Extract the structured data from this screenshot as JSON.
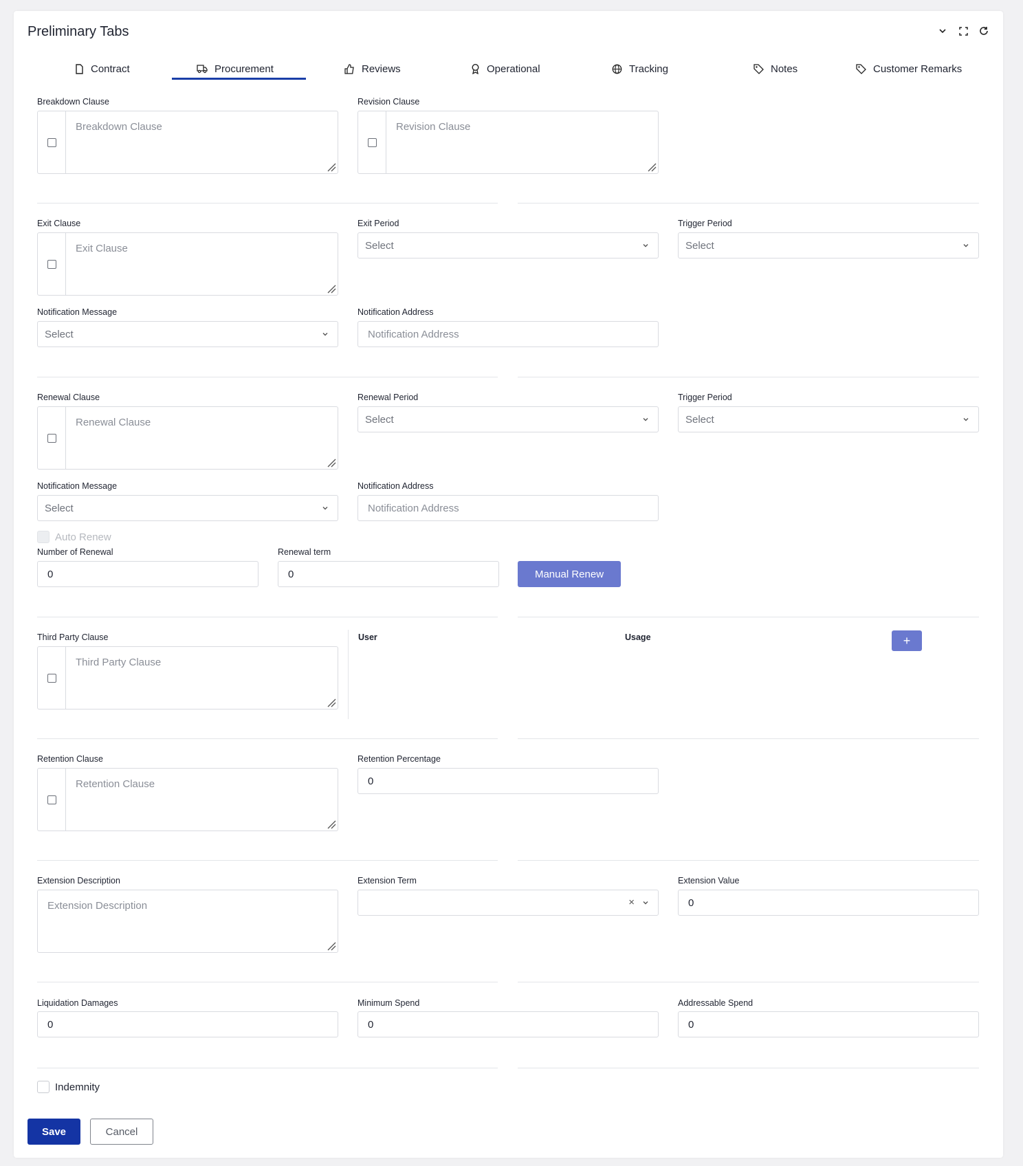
{
  "header": {
    "title": "Preliminary Tabs"
  },
  "tabs": [
    {
      "label": "Contract",
      "icon": "file-icon"
    },
    {
      "label": "Procurement",
      "icon": "truck-icon",
      "active": true
    },
    {
      "label": "Reviews",
      "icon": "thumbs-up-icon"
    },
    {
      "label": "Operational",
      "icon": "award-icon"
    },
    {
      "label": "Tracking",
      "icon": "globe-icon"
    },
    {
      "label": "Notes",
      "icon": "tag-icon"
    },
    {
      "label": "Customer Remarks",
      "icon": "tag-icon"
    }
  ],
  "breakdown": {
    "label": "Breakdown Clause",
    "placeholder": "Breakdown Clause"
  },
  "revision": {
    "label": "Revision Clause",
    "placeholder": "Revision Clause"
  },
  "exit": {
    "label": "Exit Clause",
    "placeholder": "Exit Clause",
    "period_label": "Exit Period",
    "period_value": "Select",
    "trigger_label": "Trigger Period",
    "trigger_value": "Select",
    "notif_msg_label": "Notification Message",
    "notif_msg_value": "Select",
    "notif_addr_label": "Notification Address",
    "notif_addr_placeholder": "Notification Address"
  },
  "renewal": {
    "label": "Renewal Clause",
    "placeholder": "Renewal Clause",
    "period_label": "Renewal Period",
    "period_value": "Select",
    "trigger_label": "Trigger Period",
    "trigger_value": "Select",
    "notif_msg_label": "Notification Message",
    "notif_msg_value": "Select",
    "notif_addr_label": "Notification Address",
    "notif_addr_placeholder": "Notification Address",
    "auto_renew_label": "Auto Renew",
    "number_label": "Number of Renewal",
    "number_value": "0",
    "term_label": "Renewal term",
    "term_value": "0",
    "manual_button": "Manual Renew"
  },
  "third_party": {
    "label": "Third Party Clause",
    "placeholder": "Third Party Clause",
    "col_user": "User",
    "col_usage": "Usage",
    "add_button": "+"
  },
  "retention": {
    "label": "Retention Clause",
    "placeholder": "Retention Clause",
    "pct_label": "Retention Percentage",
    "pct_value": "0"
  },
  "extension": {
    "desc_label": "Extension Description",
    "desc_placeholder": "Extension Description",
    "term_label": "Extension Term",
    "clear": "×",
    "value_label": "Extension Value",
    "value": "0"
  },
  "spend": {
    "liq_label": "Liquidation Damages",
    "liq_value": "0",
    "min_label": "Minimum Spend",
    "min_value": "0",
    "addr_label": "Addressable Spend",
    "addr_value": "0"
  },
  "indemnity": {
    "label": "Indemnity"
  },
  "actions": {
    "save": "Save",
    "cancel": "Cancel"
  },
  "colors": {
    "primary": "#1434a4",
    "accent": "#6a79cf",
    "tab_active": "#1a3ea8"
  }
}
